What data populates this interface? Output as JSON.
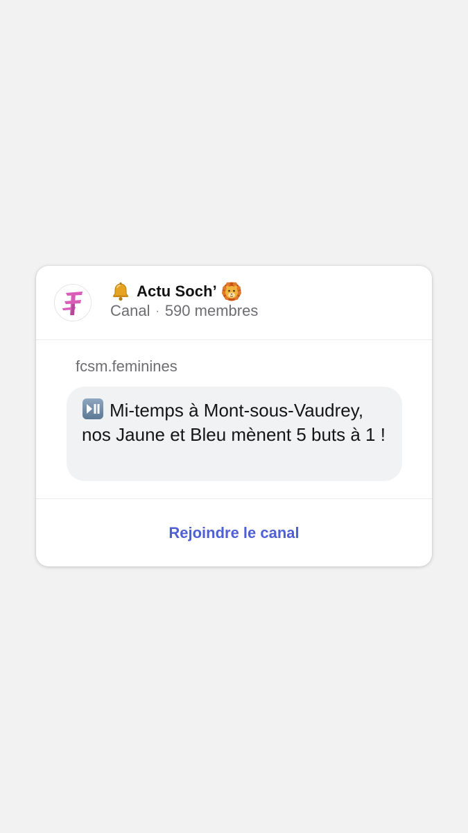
{
  "channel": {
    "title": "Actu Soch’",
    "type_label": "Canal",
    "separator": "·",
    "members": "590 membres",
    "title_prefix_icon": "bell-icon",
    "title_suffix_icon": "lion-icon",
    "avatar_icon": "ff-logo-icon"
  },
  "post": {
    "sender": "fcsm.feminines",
    "leading_icon": "play-pause-icon",
    "message": "Mi-temps à Mont-sous-Vaudrey, nos Jaune et Bleu mènent 5 buts à 1 !"
  },
  "actions": {
    "join_label": "Rejoindre le canal"
  },
  "colors": {
    "background": "#f2f2f2",
    "card": "#ffffff",
    "bubble": "#f1f2f4",
    "accent": "#4f5fd6",
    "secondary_text": "#6d6d72",
    "logo_pink": "#d85db8"
  }
}
